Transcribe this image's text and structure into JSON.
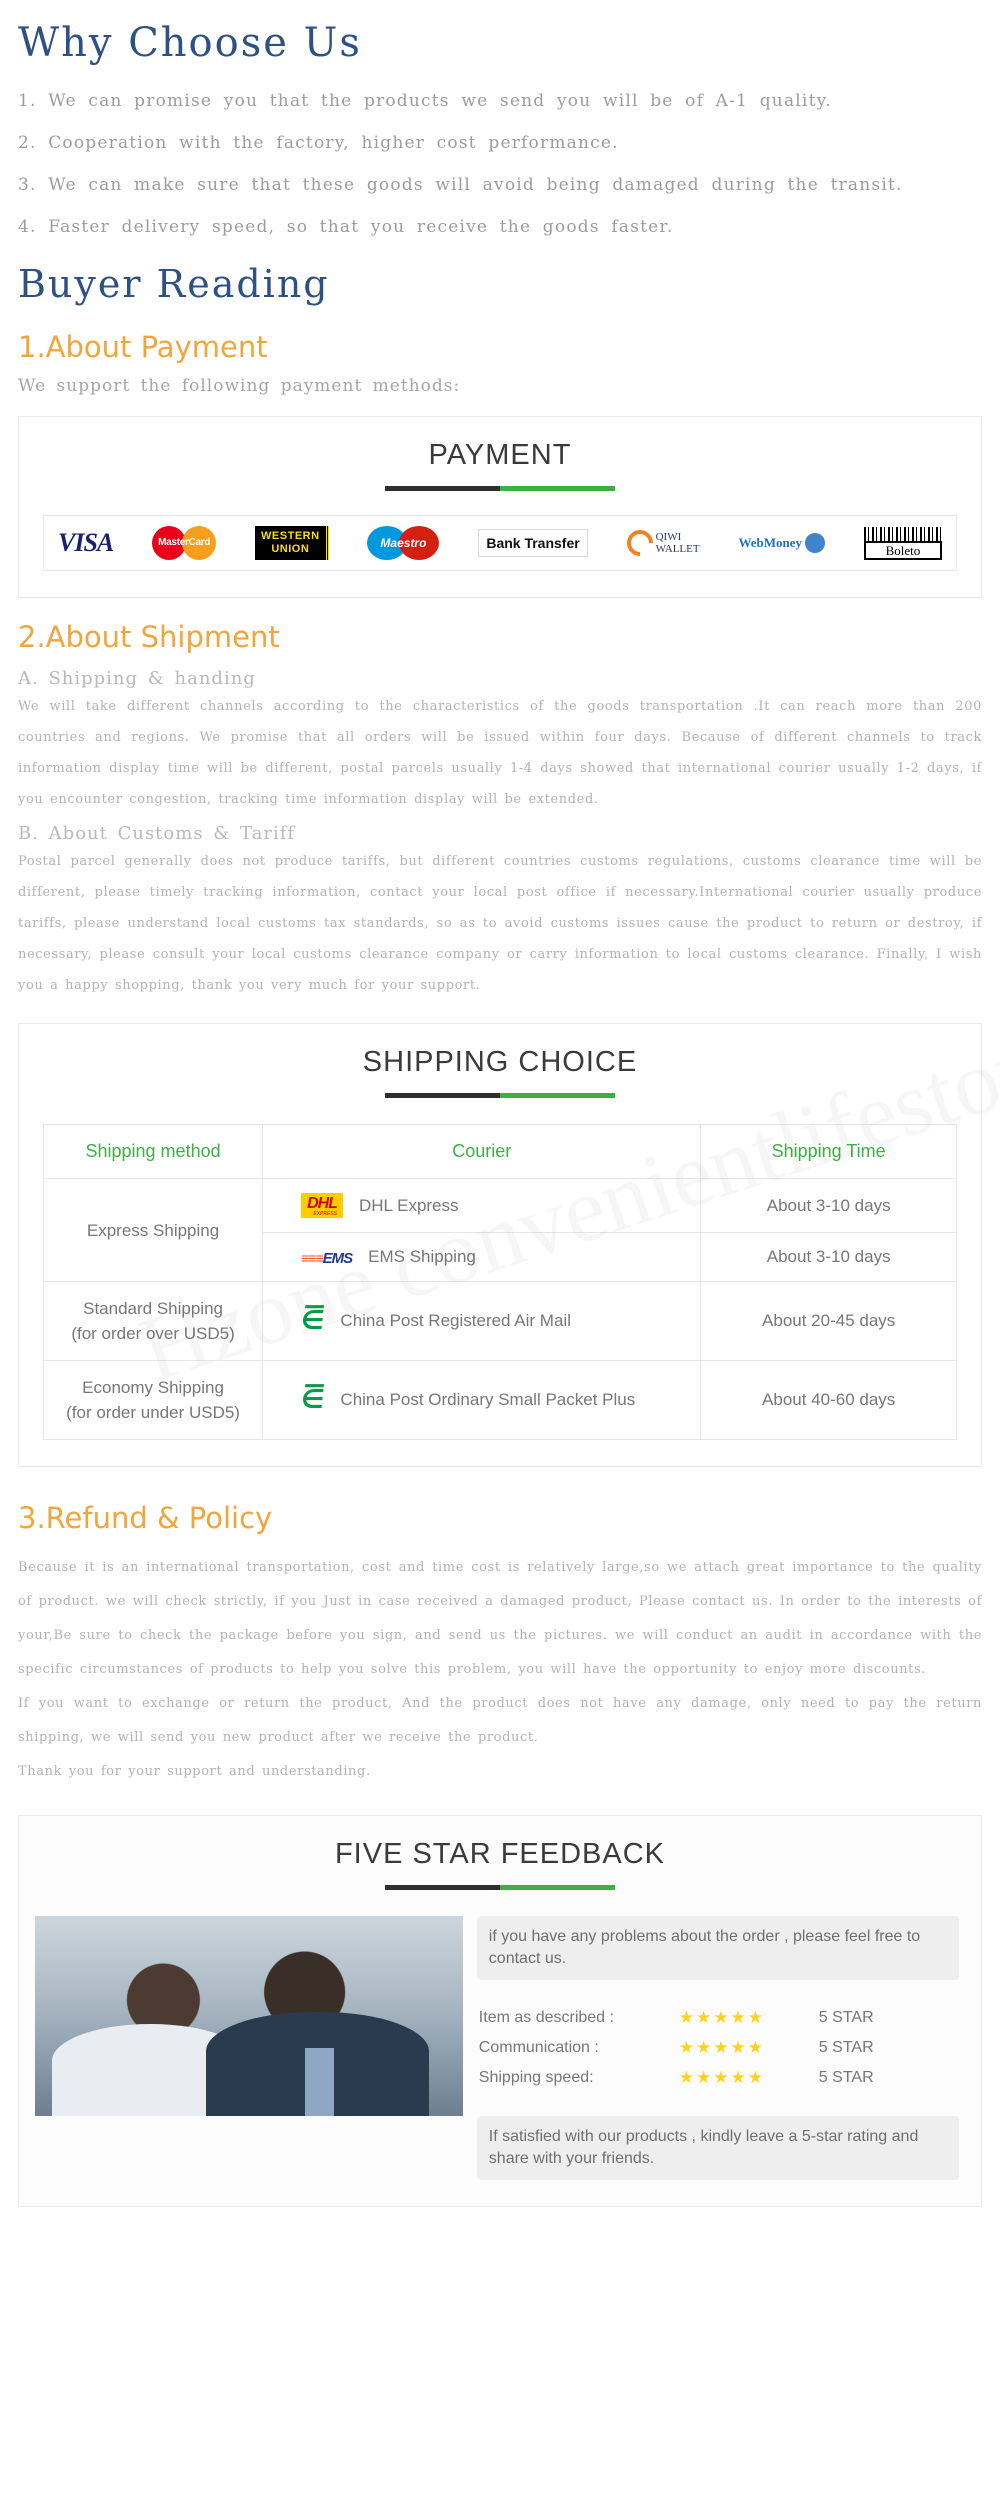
{
  "why_choose": {
    "heading": "Why Choose Us",
    "items": [
      "1. We can promise you that the products we send you will be of A-1 quality.",
      "2. Cooperation with the factory, higher cost performance.",
      "3. We can make sure that these goods will avoid being damaged during the transit.",
      "4. Faster delivery speed, so that you receive the goods faster."
    ]
  },
  "buyer_reading": {
    "heading": "Buyer  Reading"
  },
  "payment": {
    "section_heading": "1.About Payment",
    "intro": "We support  the  following  payment  methods:",
    "panel_title": "PAYMENT",
    "logos": [
      {
        "name": "visa-logo",
        "label": "VISA"
      },
      {
        "name": "mastercard-logo",
        "label": "MasterCard"
      },
      {
        "name": "western-union-logo",
        "label_line1": "WESTERN",
        "label_line2": "UNION"
      },
      {
        "name": "maestro-logo",
        "label": "Maestro"
      },
      {
        "name": "bank-transfer-logo",
        "label": "Bank Transfer"
      },
      {
        "name": "qiwi-wallet-logo",
        "label_line1": "QIWI",
        "label_line2": "WALLET"
      },
      {
        "name": "webmoney-logo",
        "label": "WebMoney"
      },
      {
        "name": "boleto-logo",
        "label": "Boleto"
      }
    ]
  },
  "shipment": {
    "section_heading": "2.About Shipment",
    "a_heading": "A. Shipping & handing",
    "a_paragraph": "We will take different channels according to the characteristics of the goods transportation .It can reach more than 200 countries and regions. We promise that all orders will be issued within four days. Because of different channels to track information display time will be different, postal parcels usually 1-4 days showed that international courier usually 1-2 days, if you encounter congestion, tracking time information display will be extended.",
    "b_heading": "B. About Customs & Tariff",
    "b_paragraph": "Postal parcel generally does not produce tariffs, but different countries customs regulations, customs clearance time will be different, please timely tracking information, contact your local post office if necessary.International courier usually produce tariffs, please understand local customs tax standards, so as to avoid customs issues cause the product to return or destroy, if necessary, please consult your local customs clearance company or carry information to local customs clearance. Finally, I wish you a happy shopping, thank you very much for your support."
  },
  "shipping_table": {
    "panel_title": "SHIPPING CHOICE",
    "headers": [
      "Shipping method",
      "Courier",
      "Shipping Time"
    ],
    "rows": [
      {
        "method": "Express Shipping",
        "method_sub": "",
        "rowspan": 2,
        "couriers": [
          {
            "logo": "dhl-logo",
            "name": "DHL Express",
            "time": "About 3-10 days"
          },
          {
            "logo": "ems-logo",
            "name": "EMS Shipping",
            "time": "About 3-10 days"
          }
        ]
      },
      {
        "method": "Standard Shipping",
        "method_sub": "(for order over USD5)",
        "rowspan": 1,
        "couriers": [
          {
            "logo": "china-post-logo",
            "name": "China Post Registered Air Mail",
            "time": "About 20-45 days"
          }
        ]
      },
      {
        "method": "Economy Shipping",
        "method_sub": "(for order under USD5)",
        "rowspan": 1,
        "couriers": [
          {
            "logo": "china-post-logo",
            "name": "China Post Ordinary Small Packet Plus",
            "time": "About 40-60 days"
          }
        ]
      }
    ]
  },
  "refund": {
    "section_heading": "3.Refund & Policy",
    "paragraphs": [
      "Because it is an international transportation, cost and time cost is relatively large,so we attach great importance to the quality of product. we will check strictly, if you Just in case received a damaged product, Please contact us. In order to the interests of your,Be sure to check the package before you sign, and send us the pictures. we will conduct an audit in accordance with the specific circumstances of products to help you solve this problem, you will have the opportunity to enjoy more discounts.",
      "If you want to exchange or return the product, And the product does not have any damage, only need to pay the return shipping, we will send you new product after we receive the product.",
      "Thank you for your support and understanding."
    ]
  },
  "feedback": {
    "panel_title": "FIVE STAR FEEDBACK",
    "bubble_top": "if you have any problems about the order , please feel free to contact us.",
    "ratings": [
      {
        "label": "Item as described :",
        "stars": "★★★★★",
        "value": "5 STAR"
      },
      {
        "label": "Communication :",
        "stars": "★★★★★",
        "value": "5 STAR"
      },
      {
        "label": "Shipping speed:",
        "stars": "★★★★★",
        "value": "5 STAR"
      }
    ],
    "bubble_bottom": "If satisfied with our products , kindly leave a 5-star rating and share with your friends."
  },
  "colors": {
    "heading_blue": "#2d5184",
    "orange": "#f0a63c",
    "green": "#3cb043",
    "body_gray": "#b2b2b2"
  },
  "watermark": "Hzone convenientlifestore"
}
